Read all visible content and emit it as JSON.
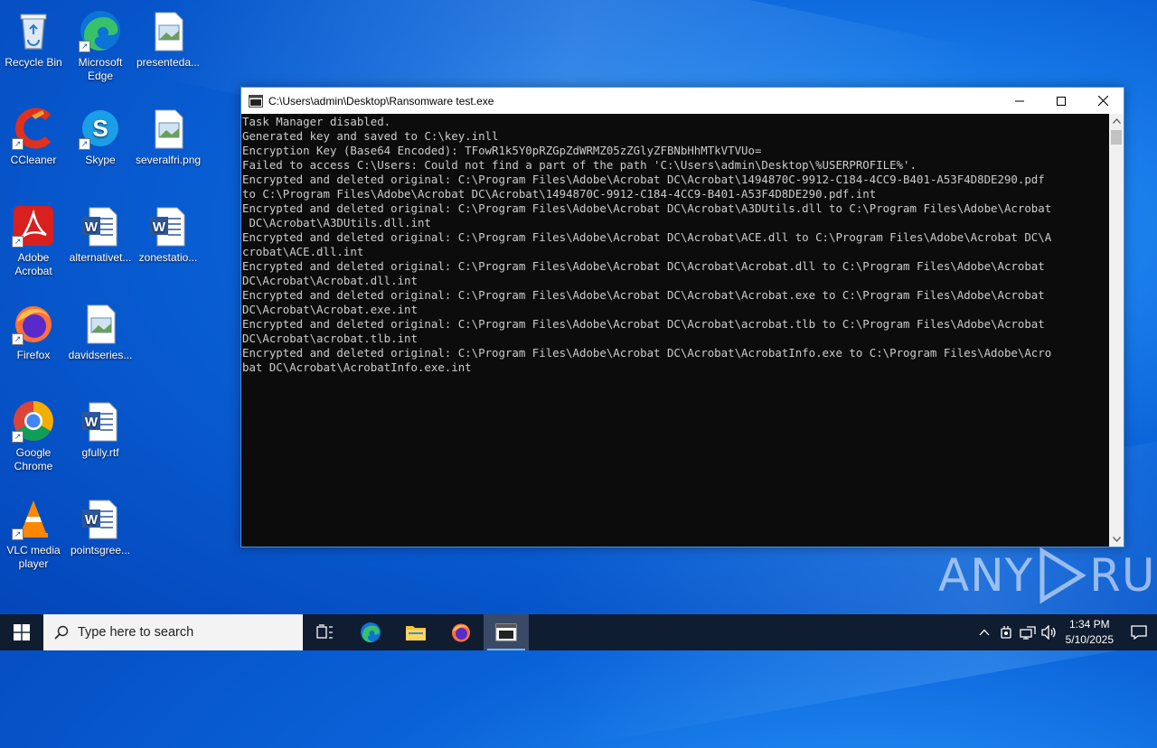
{
  "desktop": {
    "icons": [
      {
        "label": "Recycle Bin"
      },
      {
        "label": "Microsoft Edge"
      },
      {
        "label": "presenteda..."
      },
      {
        "label": "CCleaner"
      },
      {
        "label": "Skype"
      },
      {
        "label": "severalfri.png"
      },
      {
        "label": "Adobe Acrobat"
      },
      {
        "label": "alternativet..."
      },
      {
        "label": "zonestatio..."
      },
      {
        "label": "Firefox"
      },
      {
        "label": "davidseries..."
      },
      {
        "label": "Google Chrome"
      },
      {
        "label": "gfully.rtf"
      },
      {
        "label": "VLC media player"
      },
      {
        "label": "pointsgree..."
      }
    ]
  },
  "window": {
    "title": "C:\\Users\\admin\\Desktop\\Ransomware test.exe",
    "lines": [
      "Task Manager disabled.",
      "Generated key and saved to C:\\key.inll",
      "Encryption Key (Base64 Encoded): TFowR1k5Y0pRZGpZdWRMZ05zZGlyZFBNbHhMTkVTVUo=",
      "Failed to access C:\\Users: Could not find a part of the path 'C:\\Users\\admin\\Desktop\\%USERPROFILE%'.",
      "Encrypted and deleted original: C:\\Program Files\\Adobe\\Acrobat DC\\Acrobat\\1494870C-9912-C184-4CC9-B401-A53F4D8DE290.pdf",
      "to C:\\Program Files\\Adobe\\Acrobat DC\\Acrobat\\1494870C-9912-C184-4CC9-B401-A53F4D8DE290.pdf.int",
      "Encrypted and deleted original: C:\\Program Files\\Adobe\\Acrobat DC\\Acrobat\\A3DUtils.dll to C:\\Program Files\\Adobe\\Acrobat",
      " DC\\Acrobat\\A3DUtils.dll.int",
      "Encrypted and deleted original: C:\\Program Files\\Adobe\\Acrobat DC\\Acrobat\\ACE.dll to C:\\Program Files\\Adobe\\Acrobat DC\\A",
      "crobat\\ACE.dll.int",
      "Encrypted and deleted original: C:\\Program Files\\Adobe\\Acrobat DC\\Acrobat\\Acrobat.dll to C:\\Program Files\\Adobe\\Acrobat",
      "DC\\Acrobat\\Acrobat.dll.int",
      "Encrypted and deleted original: C:\\Program Files\\Adobe\\Acrobat DC\\Acrobat\\Acrobat.exe to C:\\Program Files\\Adobe\\Acrobat",
      "DC\\Acrobat\\Acrobat.exe.int",
      "Encrypted and deleted original: C:\\Program Files\\Adobe\\Acrobat DC\\Acrobat\\acrobat.tlb to C:\\Program Files\\Adobe\\Acrobat",
      "DC\\Acrobat\\acrobat.tlb.int",
      "Encrypted and deleted original: C:\\Program Files\\Adobe\\Acrobat DC\\Acrobat\\AcrobatInfo.exe to C:\\Program Files\\Adobe\\Acro",
      "bat DC\\Acrobat\\AcrobatInfo.exe.int"
    ]
  },
  "watermark": {
    "left": "ANY",
    "right": "RUN"
  },
  "taskbar": {
    "search_placeholder": "Type here to search",
    "time": "1:34 PM",
    "date": "5/10/2025"
  },
  "colors": {
    "console_bg": "#0c0c0c",
    "console_fg": "#cccccc",
    "taskbar": "#101c30",
    "accent": "#76b9ed"
  }
}
